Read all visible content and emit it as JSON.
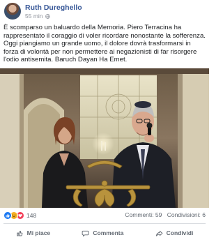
{
  "post": {
    "author": "Ruth Dureghello",
    "time": "55 min",
    "text": "È scomparso un baluardo della Memoria. Piero Terracina ha rappresentato il coraggio di voler ricordare nonostante la sofferenza. Oggi piangiamo un grande uomo, il dolore dovrà trasformarsi in forza di volontà per non permettere ai negazionisti di far risorgere l'odio antisemita. Baruch Dayan Ha Emet."
  },
  "stats": {
    "reaction_count": "148",
    "comments": "Commenti: 59",
    "shares": "Condivisioni: 6"
  },
  "actions": {
    "like": "Mi piace",
    "comment": "Commenta",
    "share": "Condividi"
  },
  "colors": {
    "author": "#385898",
    "like_blue": "#1877f2",
    "love_red": "#f33e58",
    "sad_yellow": "#f7b125"
  },
  "icons": {
    "privacy": "globe-icon",
    "like": "thumbs-up-icon",
    "comment": "comment-bubble-icon",
    "share": "share-arrow-icon"
  }
}
